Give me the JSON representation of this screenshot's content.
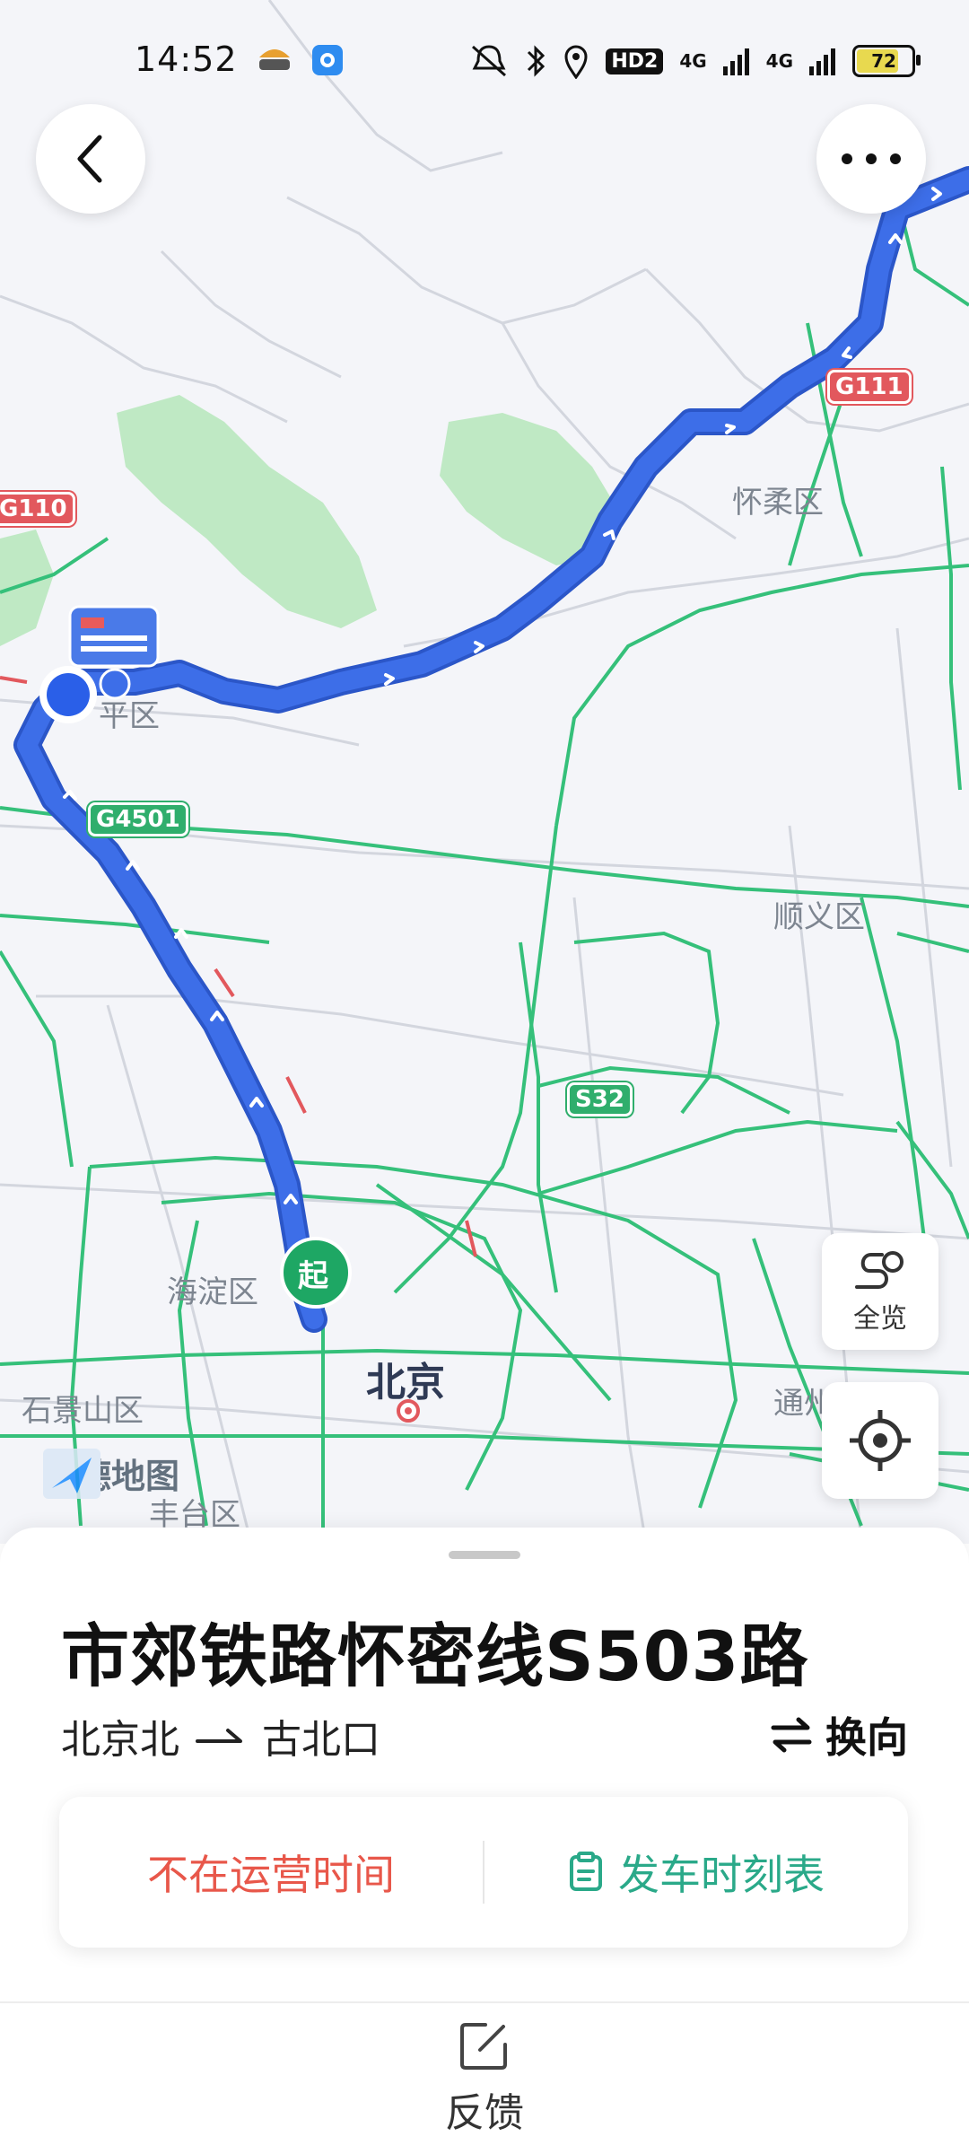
{
  "status_bar": {
    "time": "14:52",
    "hd": "HD2",
    "net1": "4G",
    "net2": "4G",
    "battery": "72"
  },
  "map": {
    "labels": {
      "huairou": "怀柔区",
      "changping": "平区",
      "shunyi": "顺义区",
      "haidian": "海淀区",
      "beijing": "北京",
      "shijingshan": "石景山区",
      "fengtai": "丰台区",
      "tongzhou": "通州"
    },
    "badges": {
      "g111": "G111",
      "g110": "G110",
      "g4501": "G4501",
      "s32": "S32"
    },
    "start_marker": "起",
    "watermark": "高德地图",
    "overview_label": "全览"
  },
  "sheet": {
    "title": "市郊铁路怀密线S503路",
    "from": "北京北",
    "to": "古北口",
    "swap_label": "换向",
    "status_text": "不在运营时间",
    "schedule_label": "发车时刻表",
    "feedback_label": "反馈"
  },
  "colors": {
    "route": "#3d6ee8",
    "road": "#35c07a",
    "accent_red": "#e8574a",
    "accent_green": "#2aa989"
  }
}
